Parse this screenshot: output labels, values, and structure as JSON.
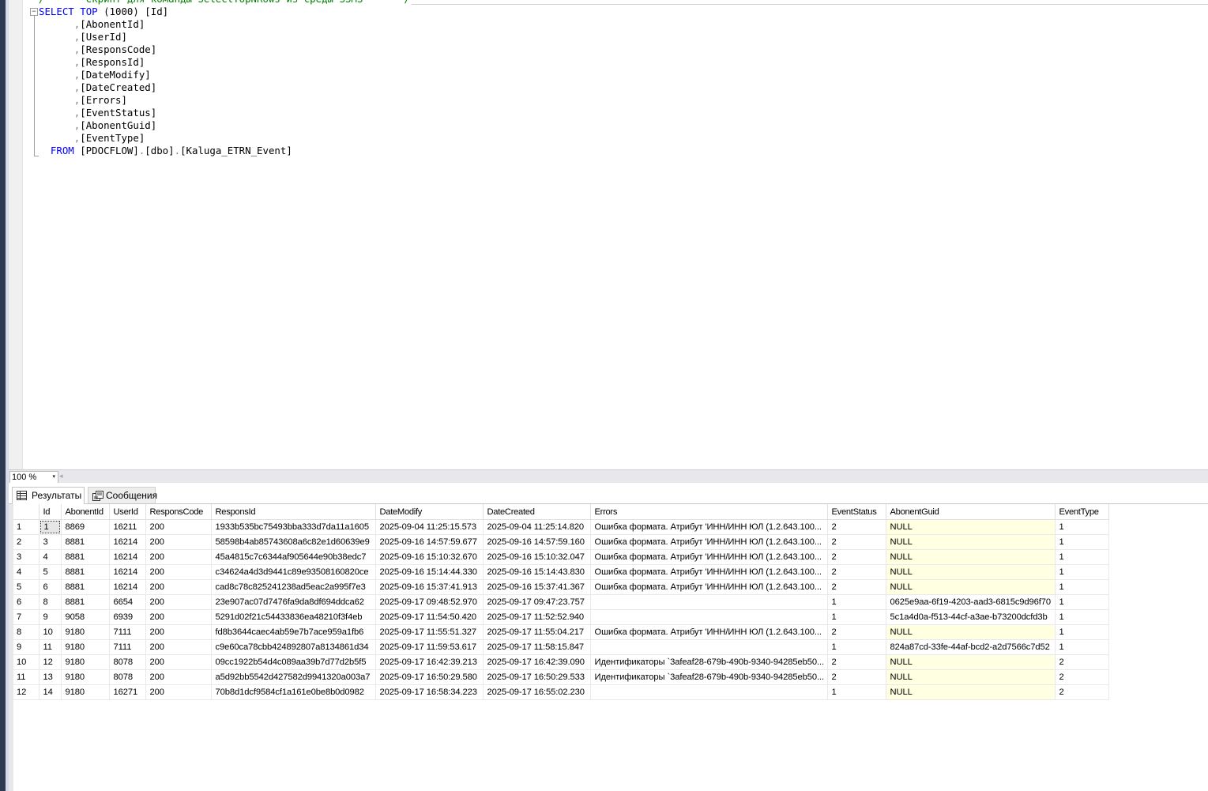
{
  "editor": {
    "lines": [
      {
        "parts": [
          {
            "t": "/",
            "c": "cm"
          },
          {
            "t": "       Скрипт для команды SelectTopNRows из среды SSMS       ",
            "c": "cm"
          },
          {
            "t": "/",
            "c": "cm"
          }
        ]
      },
      {
        "parts": [
          {
            "t": "SELECT",
            "c": "kw"
          },
          {
            "t": " ",
            "c": ""
          },
          {
            "t": "TOP",
            "c": "kw"
          },
          {
            "t": " (1000) [Id]",
            "c": ""
          }
        ]
      },
      {
        "parts": [
          {
            "t": "      ",
            "c": ""
          },
          {
            "t": ",",
            "c": "gr"
          },
          {
            "t": "[AbonentId]",
            "c": ""
          }
        ]
      },
      {
        "parts": [
          {
            "t": "      ",
            "c": ""
          },
          {
            "t": ",",
            "c": "gr"
          },
          {
            "t": "[UserId]",
            "c": ""
          }
        ]
      },
      {
        "parts": [
          {
            "t": "      ",
            "c": ""
          },
          {
            "t": ",",
            "c": "gr"
          },
          {
            "t": "[ResponsCode]",
            "c": ""
          }
        ]
      },
      {
        "parts": [
          {
            "t": "      ",
            "c": ""
          },
          {
            "t": ",",
            "c": "gr"
          },
          {
            "t": "[ResponsId]",
            "c": ""
          }
        ]
      },
      {
        "parts": [
          {
            "t": "      ",
            "c": ""
          },
          {
            "t": ",",
            "c": "gr"
          },
          {
            "t": "[DateModify]",
            "c": ""
          }
        ]
      },
      {
        "parts": [
          {
            "t": "      ",
            "c": ""
          },
          {
            "t": ",",
            "c": "gr"
          },
          {
            "t": "[DateCreated]",
            "c": ""
          }
        ]
      },
      {
        "parts": [
          {
            "t": "      ",
            "c": ""
          },
          {
            "t": ",",
            "c": "gr"
          },
          {
            "t": "[Errors]",
            "c": ""
          }
        ]
      },
      {
        "parts": [
          {
            "t": "      ",
            "c": ""
          },
          {
            "t": ",",
            "c": "gr"
          },
          {
            "t": "[EventStatus]",
            "c": ""
          }
        ]
      },
      {
        "parts": [
          {
            "t": "      ",
            "c": ""
          },
          {
            "t": ",",
            "c": "gr"
          },
          {
            "t": "[AbonentGuid]",
            "c": ""
          }
        ]
      },
      {
        "parts": [
          {
            "t": "      ",
            "c": ""
          },
          {
            "t": ",",
            "c": "gr"
          },
          {
            "t": "[EventType]",
            "c": ""
          }
        ]
      },
      {
        "parts": [
          {
            "t": "  ",
            "c": ""
          },
          {
            "t": "FROM",
            "c": "kw"
          },
          {
            "t": " [PDOCFLOW]",
            "c": ""
          },
          {
            "t": ".",
            "c": "gr"
          },
          {
            "t": "[dbo]",
            "c": ""
          },
          {
            "t": ".",
            "c": "gr"
          },
          {
            "t": "[Kaluga_ETRN_Event]",
            "c": ""
          }
        ]
      }
    ],
    "collapse_glyph": "−"
  },
  "zoom": {
    "value": "100 %",
    "arrow": "▾",
    "scroll_left": "◂"
  },
  "tabs": {
    "results": "Результаты",
    "messages": "Сообщения"
  },
  "grid": {
    "columns": [
      "",
      "Id",
      "AbonentId",
      "UserId",
      "ResponsCode",
      "ResponsId",
      "DateModify",
      "DateCreated",
      "Errors",
      "EventStatus",
      "AbonentGuid",
      "EventType"
    ],
    "rows": [
      [
        "1",
        "1",
        "8869",
        "16211",
        "200",
        "1933b535bc75493bba333d7da11a1605",
        "2025-09-04 11:25:15.573",
        "2025-09-04 11:25:14.820",
        "Ошибка формата. Атрибут 'ИНН/ИНН ЮЛ (1.2.643.100...",
        "2",
        "NULL",
        "1"
      ],
      [
        "2",
        "3",
        "8881",
        "16214",
        "200",
        "58598b4ab85743608a6c82e1d60639e9",
        "2025-09-16 14:57:59.677",
        "2025-09-16 14:57:59.160",
        "Ошибка формата. Атрибут 'ИНН/ИНН ЮЛ (1.2.643.100...",
        "2",
        "NULL",
        "1"
      ],
      [
        "3",
        "4",
        "8881",
        "16214",
        "200",
        "45a4815c7c6344af905644e90b38edc7",
        "2025-09-16 15:10:32.670",
        "2025-09-16 15:10:32.047",
        "Ошибка формата. Атрибут 'ИНН/ИНН ЮЛ (1.2.643.100...",
        "2",
        "NULL",
        "1"
      ],
      [
        "4",
        "5",
        "8881",
        "16214",
        "200",
        "c34624a4d3d9441c89e93508160820ce",
        "2025-09-16 15:14:44.330",
        "2025-09-16 15:14:43.830",
        "Ошибка формата. Атрибут 'ИНН/ИНН ЮЛ (1.2.643.100...",
        "2",
        "NULL",
        "1"
      ],
      [
        "5",
        "6",
        "8881",
        "16214",
        "200",
        "cad8c78c825241238ad5eac2a995f7e3",
        "2025-09-16 15:37:41.913",
        "2025-09-16 15:37:41.367",
        "Ошибка формата. Атрибут 'ИНН/ИНН ЮЛ (1.2.643.100...",
        "2",
        "NULL",
        "1"
      ],
      [
        "6",
        "8",
        "8881",
        "6654",
        "200",
        "23e907ac07d7476fa9da8df694ddca62",
        "2025-09-17 09:48:52.970",
        "2025-09-17 09:47:23.757",
        "",
        "1",
        "0625e9aa-6f19-4203-aad3-6815c9d96f70",
        "1"
      ],
      [
        "7",
        "9",
        "9058",
        "6939",
        "200",
        "5291d02f21c54433836ea48210f3f4eb",
        "2025-09-17 11:54:50.420",
        "2025-09-17 11:52:52.940",
        "",
        "1",
        "5c1a4d0a-f513-44cf-a3ae-b73200dcfd3b",
        "1"
      ],
      [
        "8",
        "10",
        "9180",
        "7111",
        "200",
        "fd8b3644caec4ab59e7b7ace959a1fb6",
        "2025-09-17 11:55:51.327",
        "2025-09-17 11:55:04.217",
        "Ошибка формата. Атрибут 'ИНН/ИНН ЮЛ (1.2.643.100...",
        "2",
        "NULL",
        "1"
      ],
      [
        "9",
        "11",
        "9180",
        "7111",
        "200",
        "c9e60ca78cbb424892807a8134861d34",
        "2025-09-17 11:59:53.617",
        "2025-09-17 11:58:15.847",
        "",
        "1",
        "824a87cd-33fe-44af-bcd2-a2d7566c7d52",
        "1"
      ],
      [
        "10",
        "12",
        "9180",
        "8078",
        "200",
        "09cc1922b54d4c089aa39b7d77d2b5f5",
        "2025-09-17 16:42:39.213",
        "2025-09-17 16:42:39.090",
        "Идентификаторы `3afeaf28-679b-490b-9340-94285eb50...",
        "2",
        "NULL",
        "2"
      ],
      [
        "11",
        "13",
        "9180",
        "8078",
        "200",
        "a5d92bb5542d427582d9941320a003a7",
        "2025-09-17 16:50:29.580",
        "2025-09-17 16:50:29.533",
        "Идентификаторы `3afeaf28-679b-490b-9340-94285eb50...",
        "2",
        "NULL",
        "2"
      ],
      [
        "12",
        "14",
        "9180",
        "16271",
        "200",
        "70b8d1dcf9584cf1a161e0be8b0d0982",
        "2025-09-17 16:58:34.223",
        "2025-09-17 16:55:02.230",
        "",
        "1",
        "NULL",
        "2"
      ]
    ]
  },
  "colors": {
    "keyword": "#0000ff",
    "comment": "#008000",
    "null_bg": "#ffffe1"
  }
}
